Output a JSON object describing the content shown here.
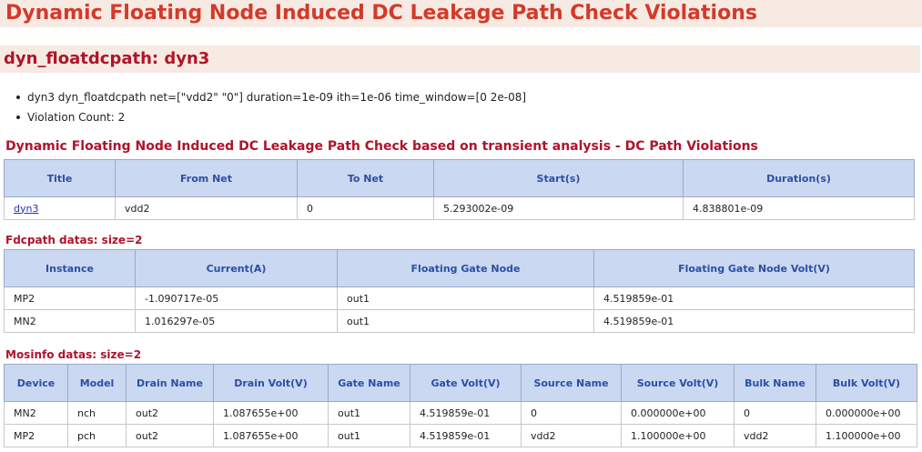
{
  "page_title": "Dynamic Floating Node Induced DC Leakage Path Check Violations",
  "section_title": "dyn_floatdcpath: dyn3",
  "info": [
    "dyn3 dyn_floatdcpath net=[\"vdd2\" \"0\"] duration=1e-09 ith=1e-06 time_window=[0 2e-08]",
    "Violation Count: 2"
  ],
  "violations_heading": "Dynamic Floating Node Induced DC Leakage Path Check based on transient analysis - DC Path Violations",
  "violations_table": {
    "headers": [
      "Title",
      "From Net",
      "To Net",
      "Start(s)",
      "Duration(s)"
    ],
    "rows": [
      [
        "dyn3",
        "vdd2",
        "0",
        "5.293002e-09",
        "4.838801e-09"
      ]
    ]
  },
  "fdcpath_heading": "Fdcpath datas: size=2",
  "fdcpath_table": {
    "headers": [
      "Instance",
      "Current(A)",
      "Floating Gate Node",
      "Floating Gate Node Volt(V)"
    ],
    "rows": [
      [
        "MP2",
        "-1.090717e-05",
        "out1",
        "4.519859e-01"
      ],
      [
        "MN2",
        "1.016297e-05",
        "out1",
        "4.519859e-01"
      ]
    ]
  },
  "mosinfo_heading": "Mosinfo datas: size=2",
  "mosinfo_table": {
    "headers": [
      "Device",
      "Model",
      "Drain Name",
      "Drain Volt(V)",
      "Gate Name",
      "Gate Volt(V)",
      "Source Name",
      "Source Volt(V)",
      "Bulk Name",
      "Bulk Volt(V)"
    ],
    "rows": [
      [
        "MN2",
        "nch",
        "out2",
        "1.087655e+00",
        "out1",
        "4.519859e-01",
        "0",
        "0.000000e+00",
        "0",
        "0.000000e+00"
      ],
      [
        "MP2",
        "pch",
        "out2",
        "1.087655e+00",
        "out1",
        "4.519859e-01",
        "vdd2",
        "1.100000e+00",
        "vdd2",
        "1.100000e+00"
      ]
    ]
  },
  "colors": {
    "title_red": "#d33a2a",
    "heading_red": "#b0132a",
    "header_band": "#f7eae3",
    "table_header_bg": "#cbd8f1",
    "table_header_text": "#2c4ea4",
    "link": "#2233bb"
  }
}
